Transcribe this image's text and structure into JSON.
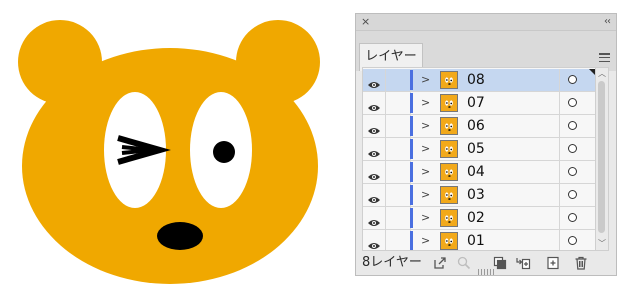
{
  "colors": {
    "bear_fill": "#f0a800",
    "eye_white": "#ffffff",
    "feature_black": "#000000",
    "selected_row": "#c5d7f0",
    "layer_color": "#4a6fe0"
  },
  "illustration": {
    "subject": "bear-face",
    "left_eye_state": "winking",
    "right_eye_state": "open"
  },
  "panel": {
    "close_glyph": "×",
    "collapse_glyph": "‹‹",
    "tab_label": "レイヤー",
    "menu_icon": "hamburger-icon",
    "layers": [
      {
        "name": "08",
        "visible": true,
        "selected": true
      },
      {
        "name": "07",
        "visible": true,
        "selected": false
      },
      {
        "name": "06",
        "visible": true,
        "selected": false
      },
      {
        "name": "05",
        "visible": true,
        "selected": false
      },
      {
        "name": "04",
        "visible": true,
        "selected": false
      },
      {
        "name": "03",
        "visible": true,
        "selected": false
      },
      {
        "name": "02",
        "visible": true,
        "selected": false
      },
      {
        "name": "01",
        "visible": true,
        "selected": false
      }
    ],
    "footer": {
      "layer_count_label": "8レイヤー",
      "icons": [
        "export-icon",
        "search-icon",
        "clipping-mask-icon",
        "new-sublayer-icon",
        "new-layer-icon",
        "trash-icon"
      ]
    }
  }
}
